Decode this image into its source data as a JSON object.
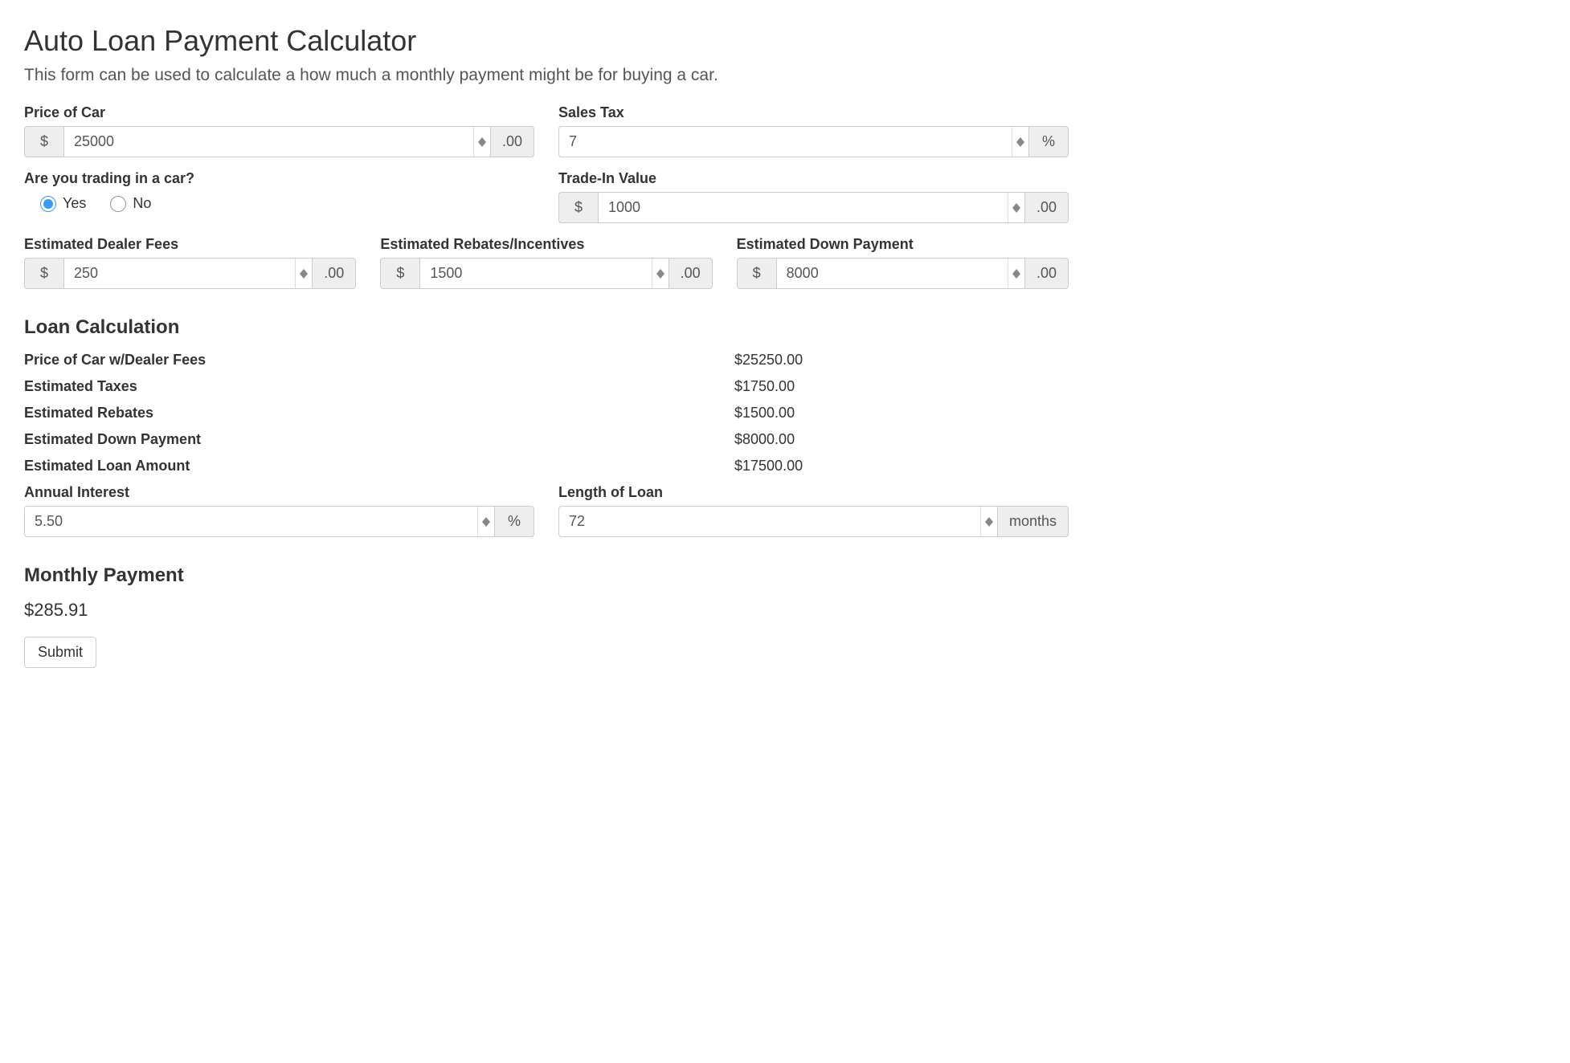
{
  "header": {
    "title": "Auto Loan Payment Calculator",
    "lead": "This form can be used to calculate a how much a monthly payment might be for buying a car."
  },
  "inputRow1": {
    "price": {
      "label": "Price of Car",
      "prefix": "$",
      "value": "25000",
      "suffix": ".00"
    },
    "salesTax": {
      "label": "Sales Tax",
      "value": "7",
      "suffix": "%"
    }
  },
  "tradeIn": {
    "questionLabel": "Are you trading in a car?",
    "options": {
      "yes": "Yes",
      "no": "No"
    },
    "selected": "yes",
    "valueLabel": "Trade-In Value",
    "prefix": "$",
    "value": "1000",
    "suffix": ".00"
  },
  "inputRow3": {
    "dealerFees": {
      "label": "Estimated Dealer Fees",
      "prefix": "$",
      "value": "250",
      "suffix": ".00"
    },
    "rebates": {
      "label": "Estimated Rebates/Incentives",
      "prefix": "$",
      "value": "1500",
      "suffix": ".00"
    },
    "downPayment": {
      "label": "Estimated Down Payment",
      "prefix": "$",
      "value": "8000",
      "suffix": ".00"
    }
  },
  "loanCalc": {
    "heading": "Loan Calculation",
    "rows": {
      "priceWithFees": {
        "label": "Price of Car w/Dealer Fees",
        "value": "$25250.00"
      },
      "estTaxes": {
        "label": "Estimated Taxes",
        "value": "$1750.00"
      },
      "estRebates": {
        "label": "Estimated Rebates",
        "value": "$1500.00"
      },
      "estDown": {
        "label": "Estimated Down Payment",
        "value": "$8000.00"
      },
      "estLoan": {
        "label": "Estimated Loan Amount",
        "value": "$17500.00"
      }
    },
    "interest": {
      "label": "Annual Interest",
      "value": "5.50",
      "suffix": "%"
    },
    "length": {
      "label": "Length of Loan",
      "value": "72",
      "suffix": "months"
    }
  },
  "monthly": {
    "heading": "Monthly Payment",
    "value": "$285.91"
  },
  "actions": {
    "submit": "Submit"
  }
}
